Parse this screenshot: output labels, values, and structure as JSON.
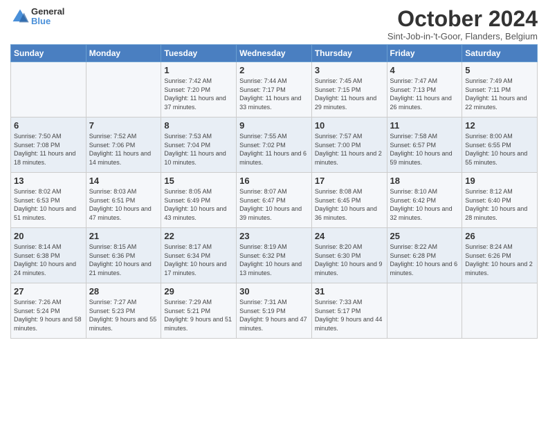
{
  "logo": {
    "line1": "General",
    "line2": "Blue"
  },
  "title": "October 2024",
  "subtitle": "Sint-Job-in-'t-Goor, Flanders, Belgium",
  "weekdays": [
    "Sunday",
    "Monday",
    "Tuesday",
    "Wednesday",
    "Thursday",
    "Friday",
    "Saturday"
  ],
  "weeks": [
    [
      {
        "day": "",
        "sunrise": "",
        "sunset": "",
        "daylight": ""
      },
      {
        "day": "",
        "sunrise": "",
        "sunset": "",
        "daylight": ""
      },
      {
        "day": "1",
        "sunrise": "Sunrise: 7:42 AM",
        "sunset": "Sunset: 7:20 PM",
        "daylight": "Daylight: 11 hours and 37 minutes."
      },
      {
        "day": "2",
        "sunrise": "Sunrise: 7:44 AM",
        "sunset": "Sunset: 7:17 PM",
        "daylight": "Daylight: 11 hours and 33 minutes."
      },
      {
        "day": "3",
        "sunrise": "Sunrise: 7:45 AM",
        "sunset": "Sunset: 7:15 PM",
        "daylight": "Daylight: 11 hours and 29 minutes."
      },
      {
        "day": "4",
        "sunrise": "Sunrise: 7:47 AM",
        "sunset": "Sunset: 7:13 PM",
        "daylight": "Daylight: 11 hours and 26 minutes."
      },
      {
        "day": "5",
        "sunrise": "Sunrise: 7:49 AM",
        "sunset": "Sunset: 7:11 PM",
        "daylight": "Daylight: 11 hours and 22 minutes."
      }
    ],
    [
      {
        "day": "6",
        "sunrise": "Sunrise: 7:50 AM",
        "sunset": "Sunset: 7:08 PM",
        "daylight": "Daylight: 11 hours and 18 minutes."
      },
      {
        "day": "7",
        "sunrise": "Sunrise: 7:52 AM",
        "sunset": "Sunset: 7:06 PM",
        "daylight": "Daylight: 11 hours and 14 minutes."
      },
      {
        "day": "8",
        "sunrise": "Sunrise: 7:53 AM",
        "sunset": "Sunset: 7:04 PM",
        "daylight": "Daylight: 11 hours and 10 minutes."
      },
      {
        "day": "9",
        "sunrise": "Sunrise: 7:55 AM",
        "sunset": "Sunset: 7:02 PM",
        "daylight": "Daylight: 11 hours and 6 minutes."
      },
      {
        "day": "10",
        "sunrise": "Sunrise: 7:57 AM",
        "sunset": "Sunset: 7:00 PM",
        "daylight": "Daylight: 11 hours and 2 minutes."
      },
      {
        "day": "11",
        "sunrise": "Sunrise: 7:58 AM",
        "sunset": "Sunset: 6:57 PM",
        "daylight": "Daylight: 10 hours and 59 minutes."
      },
      {
        "day": "12",
        "sunrise": "Sunrise: 8:00 AM",
        "sunset": "Sunset: 6:55 PM",
        "daylight": "Daylight: 10 hours and 55 minutes."
      }
    ],
    [
      {
        "day": "13",
        "sunrise": "Sunrise: 8:02 AM",
        "sunset": "Sunset: 6:53 PM",
        "daylight": "Daylight: 10 hours and 51 minutes."
      },
      {
        "day": "14",
        "sunrise": "Sunrise: 8:03 AM",
        "sunset": "Sunset: 6:51 PM",
        "daylight": "Daylight: 10 hours and 47 minutes."
      },
      {
        "day": "15",
        "sunrise": "Sunrise: 8:05 AM",
        "sunset": "Sunset: 6:49 PM",
        "daylight": "Daylight: 10 hours and 43 minutes."
      },
      {
        "day": "16",
        "sunrise": "Sunrise: 8:07 AM",
        "sunset": "Sunset: 6:47 PM",
        "daylight": "Daylight: 10 hours and 39 minutes."
      },
      {
        "day": "17",
        "sunrise": "Sunrise: 8:08 AM",
        "sunset": "Sunset: 6:45 PM",
        "daylight": "Daylight: 10 hours and 36 minutes."
      },
      {
        "day": "18",
        "sunrise": "Sunrise: 8:10 AM",
        "sunset": "Sunset: 6:42 PM",
        "daylight": "Daylight: 10 hours and 32 minutes."
      },
      {
        "day": "19",
        "sunrise": "Sunrise: 8:12 AM",
        "sunset": "Sunset: 6:40 PM",
        "daylight": "Daylight: 10 hours and 28 minutes."
      }
    ],
    [
      {
        "day": "20",
        "sunrise": "Sunrise: 8:14 AM",
        "sunset": "Sunset: 6:38 PM",
        "daylight": "Daylight: 10 hours and 24 minutes."
      },
      {
        "day": "21",
        "sunrise": "Sunrise: 8:15 AM",
        "sunset": "Sunset: 6:36 PM",
        "daylight": "Daylight: 10 hours and 21 minutes."
      },
      {
        "day": "22",
        "sunrise": "Sunrise: 8:17 AM",
        "sunset": "Sunset: 6:34 PM",
        "daylight": "Daylight: 10 hours and 17 minutes."
      },
      {
        "day": "23",
        "sunrise": "Sunrise: 8:19 AM",
        "sunset": "Sunset: 6:32 PM",
        "daylight": "Daylight: 10 hours and 13 minutes."
      },
      {
        "day": "24",
        "sunrise": "Sunrise: 8:20 AM",
        "sunset": "Sunset: 6:30 PM",
        "daylight": "Daylight: 10 hours and 9 minutes."
      },
      {
        "day": "25",
        "sunrise": "Sunrise: 8:22 AM",
        "sunset": "Sunset: 6:28 PM",
        "daylight": "Daylight: 10 hours and 6 minutes."
      },
      {
        "day": "26",
        "sunrise": "Sunrise: 8:24 AM",
        "sunset": "Sunset: 6:26 PM",
        "daylight": "Daylight: 10 hours and 2 minutes."
      }
    ],
    [
      {
        "day": "27",
        "sunrise": "Sunrise: 7:26 AM",
        "sunset": "Sunset: 5:24 PM",
        "daylight": "Daylight: 9 hours and 58 minutes."
      },
      {
        "day": "28",
        "sunrise": "Sunrise: 7:27 AM",
        "sunset": "Sunset: 5:23 PM",
        "daylight": "Daylight: 9 hours and 55 minutes."
      },
      {
        "day": "29",
        "sunrise": "Sunrise: 7:29 AM",
        "sunset": "Sunset: 5:21 PM",
        "daylight": "Daylight: 9 hours and 51 minutes."
      },
      {
        "day": "30",
        "sunrise": "Sunrise: 7:31 AM",
        "sunset": "Sunset: 5:19 PM",
        "daylight": "Daylight: 9 hours and 47 minutes."
      },
      {
        "day": "31",
        "sunrise": "Sunrise: 7:33 AM",
        "sunset": "Sunset: 5:17 PM",
        "daylight": "Daylight: 9 hours and 44 minutes."
      },
      {
        "day": "",
        "sunrise": "",
        "sunset": "",
        "daylight": ""
      },
      {
        "day": "",
        "sunrise": "",
        "sunset": "",
        "daylight": ""
      }
    ]
  ]
}
